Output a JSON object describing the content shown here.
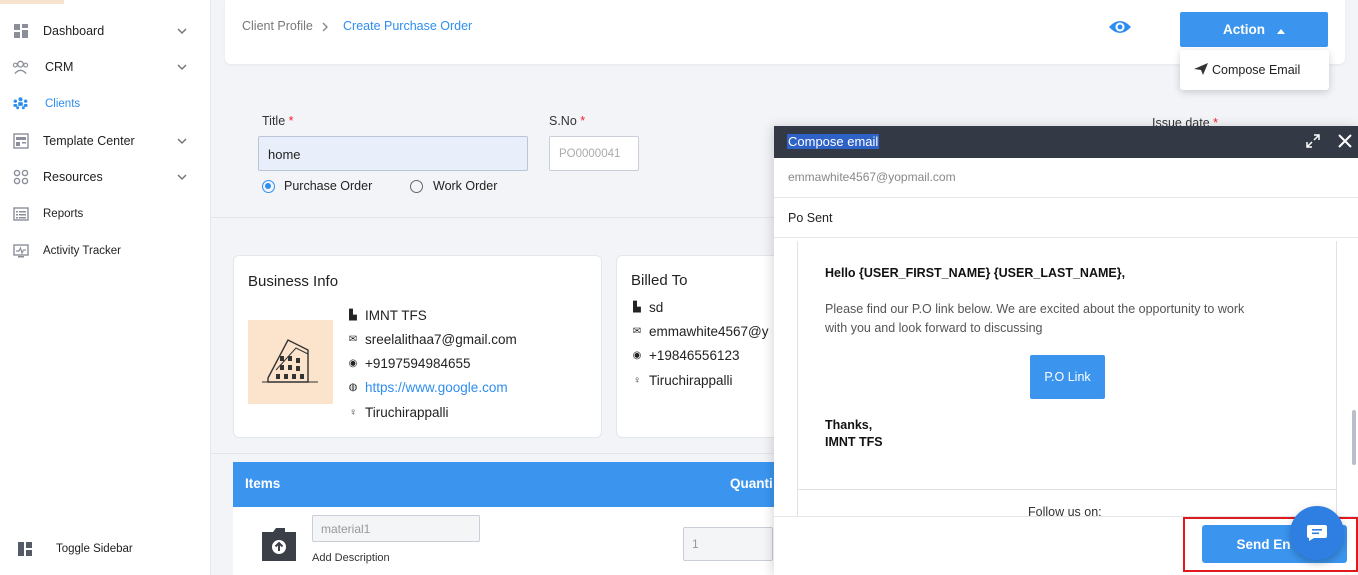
{
  "sidebar": {
    "items": [
      {
        "label": "Dashboard",
        "icon": "dashboard-icon",
        "has_chevron": true
      },
      {
        "label": "CRM",
        "icon": "crm-icon",
        "has_chevron": true
      },
      {
        "label": "Clients",
        "icon": "clients-icon",
        "has_chevron": false,
        "active": true
      },
      {
        "label": "Template Center",
        "icon": "template-icon",
        "has_chevron": true
      },
      {
        "label": "Resources",
        "icon": "resources-icon",
        "has_chevron": true
      },
      {
        "label": "Reports",
        "icon": "reports-icon",
        "has_chevron": false
      },
      {
        "label": "Activity Tracker",
        "icon": "activity-icon",
        "has_chevron": false
      }
    ],
    "toggle_label": "Toggle Sidebar"
  },
  "breadcrumb": {
    "parent": "Client Profile",
    "current": "Create Purchase Order"
  },
  "action": {
    "label": "Action",
    "menu_item": "Compose Email"
  },
  "form": {
    "title_label": "Title",
    "title_value": "home",
    "sno_label": "S.No",
    "sno_placeholder": "PO0000041",
    "issue_date_label": "Issue date",
    "required_mark": "*",
    "radio_po": "Purchase Order",
    "radio_wo": "Work Order"
  },
  "business_info": {
    "heading": "Business Info",
    "name": "IMNT TFS",
    "email": "sreelalithaa7@gmail.com",
    "phone": "+9197594984655",
    "website": "https://www.google.com",
    "location": "Tiruchirappalli"
  },
  "billed_to": {
    "heading": "Billed To",
    "name": "sd",
    "email": "emmawhite4567@y",
    "phone": "+19846556123",
    "location": "Tiruchirappalli"
  },
  "items_table": {
    "header_items": "Items",
    "header_quantity": "Quanti",
    "row_material_placeholder": "material1",
    "row_add_description": "Add Description",
    "row_quantity_placeholder": "1"
  },
  "email": {
    "title": "Compose email",
    "to": "emmawhite4567@yopmail.com",
    "subject": "Po Sent",
    "greeting": "Hello {USER_FIRST_NAME} {USER_LAST_NAME},",
    "body_line1": "Please find our P.O link below. We are excited about the opportunity to work",
    "body_line2": "with you and look forward to discussing",
    "link_button": "P.O Link",
    "signoff": "Thanks,",
    "signature": "IMNT TFS",
    "footer": "Follow us on:",
    "send_label": "Send En"
  },
  "colors": {
    "accent": "#3b95ef",
    "titlebar": "#343a45",
    "highlight_outline": "#e0191f"
  }
}
